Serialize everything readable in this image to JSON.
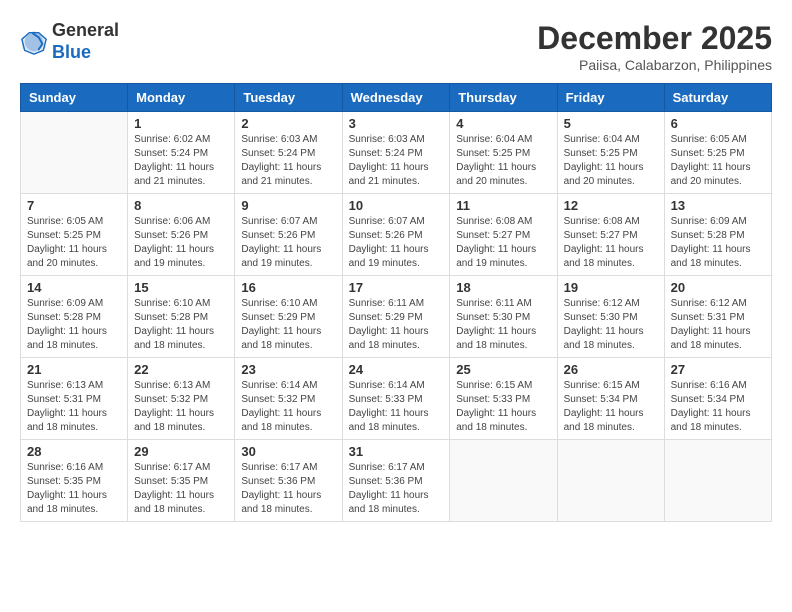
{
  "header": {
    "logo_line1": "General",
    "logo_line2": "Blue",
    "month_year": "December 2025",
    "location": "Paiisa, Calabarzon, Philippines"
  },
  "weekdays": [
    "Sunday",
    "Monday",
    "Tuesday",
    "Wednesday",
    "Thursday",
    "Friday",
    "Saturday"
  ],
  "weeks": [
    [
      {
        "day": "",
        "info": ""
      },
      {
        "day": "1",
        "info": "Sunrise: 6:02 AM\nSunset: 5:24 PM\nDaylight: 11 hours\nand 21 minutes."
      },
      {
        "day": "2",
        "info": "Sunrise: 6:03 AM\nSunset: 5:24 PM\nDaylight: 11 hours\nand 21 minutes."
      },
      {
        "day": "3",
        "info": "Sunrise: 6:03 AM\nSunset: 5:24 PM\nDaylight: 11 hours\nand 21 minutes."
      },
      {
        "day": "4",
        "info": "Sunrise: 6:04 AM\nSunset: 5:25 PM\nDaylight: 11 hours\nand 20 minutes."
      },
      {
        "day": "5",
        "info": "Sunrise: 6:04 AM\nSunset: 5:25 PM\nDaylight: 11 hours\nand 20 minutes."
      },
      {
        "day": "6",
        "info": "Sunrise: 6:05 AM\nSunset: 5:25 PM\nDaylight: 11 hours\nand 20 minutes."
      }
    ],
    [
      {
        "day": "7",
        "info": "Sunrise: 6:05 AM\nSunset: 5:25 PM\nDaylight: 11 hours\nand 20 minutes."
      },
      {
        "day": "8",
        "info": "Sunrise: 6:06 AM\nSunset: 5:26 PM\nDaylight: 11 hours\nand 19 minutes."
      },
      {
        "day": "9",
        "info": "Sunrise: 6:07 AM\nSunset: 5:26 PM\nDaylight: 11 hours\nand 19 minutes."
      },
      {
        "day": "10",
        "info": "Sunrise: 6:07 AM\nSunset: 5:26 PM\nDaylight: 11 hours\nand 19 minutes."
      },
      {
        "day": "11",
        "info": "Sunrise: 6:08 AM\nSunset: 5:27 PM\nDaylight: 11 hours\nand 19 minutes."
      },
      {
        "day": "12",
        "info": "Sunrise: 6:08 AM\nSunset: 5:27 PM\nDaylight: 11 hours\nand 18 minutes."
      },
      {
        "day": "13",
        "info": "Sunrise: 6:09 AM\nSunset: 5:28 PM\nDaylight: 11 hours\nand 18 minutes."
      }
    ],
    [
      {
        "day": "14",
        "info": "Sunrise: 6:09 AM\nSunset: 5:28 PM\nDaylight: 11 hours\nand 18 minutes."
      },
      {
        "day": "15",
        "info": "Sunrise: 6:10 AM\nSunset: 5:28 PM\nDaylight: 11 hours\nand 18 minutes."
      },
      {
        "day": "16",
        "info": "Sunrise: 6:10 AM\nSunset: 5:29 PM\nDaylight: 11 hours\nand 18 minutes."
      },
      {
        "day": "17",
        "info": "Sunrise: 6:11 AM\nSunset: 5:29 PM\nDaylight: 11 hours\nand 18 minutes."
      },
      {
        "day": "18",
        "info": "Sunrise: 6:11 AM\nSunset: 5:30 PM\nDaylight: 11 hours\nand 18 minutes."
      },
      {
        "day": "19",
        "info": "Sunrise: 6:12 AM\nSunset: 5:30 PM\nDaylight: 11 hours\nand 18 minutes."
      },
      {
        "day": "20",
        "info": "Sunrise: 6:12 AM\nSunset: 5:31 PM\nDaylight: 11 hours\nand 18 minutes."
      }
    ],
    [
      {
        "day": "21",
        "info": "Sunrise: 6:13 AM\nSunset: 5:31 PM\nDaylight: 11 hours\nand 18 minutes."
      },
      {
        "day": "22",
        "info": "Sunrise: 6:13 AM\nSunset: 5:32 PM\nDaylight: 11 hours\nand 18 minutes."
      },
      {
        "day": "23",
        "info": "Sunrise: 6:14 AM\nSunset: 5:32 PM\nDaylight: 11 hours\nand 18 minutes."
      },
      {
        "day": "24",
        "info": "Sunrise: 6:14 AM\nSunset: 5:33 PM\nDaylight: 11 hours\nand 18 minutes."
      },
      {
        "day": "25",
        "info": "Sunrise: 6:15 AM\nSunset: 5:33 PM\nDaylight: 11 hours\nand 18 minutes."
      },
      {
        "day": "26",
        "info": "Sunrise: 6:15 AM\nSunset: 5:34 PM\nDaylight: 11 hours\nand 18 minutes."
      },
      {
        "day": "27",
        "info": "Sunrise: 6:16 AM\nSunset: 5:34 PM\nDaylight: 11 hours\nand 18 minutes."
      }
    ],
    [
      {
        "day": "28",
        "info": "Sunrise: 6:16 AM\nSunset: 5:35 PM\nDaylight: 11 hours\nand 18 minutes."
      },
      {
        "day": "29",
        "info": "Sunrise: 6:17 AM\nSunset: 5:35 PM\nDaylight: 11 hours\nand 18 minutes."
      },
      {
        "day": "30",
        "info": "Sunrise: 6:17 AM\nSunset: 5:36 PM\nDaylight: 11 hours\nand 18 minutes."
      },
      {
        "day": "31",
        "info": "Sunrise: 6:17 AM\nSunset: 5:36 PM\nDaylight: 11 hours\nand 18 minutes."
      },
      {
        "day": "",
        "info": ""
      },
      {
        "day": "",
        "info": ""
      },
      {
        "day": "",
        "info": ""
      }
    ]
  ]
}
